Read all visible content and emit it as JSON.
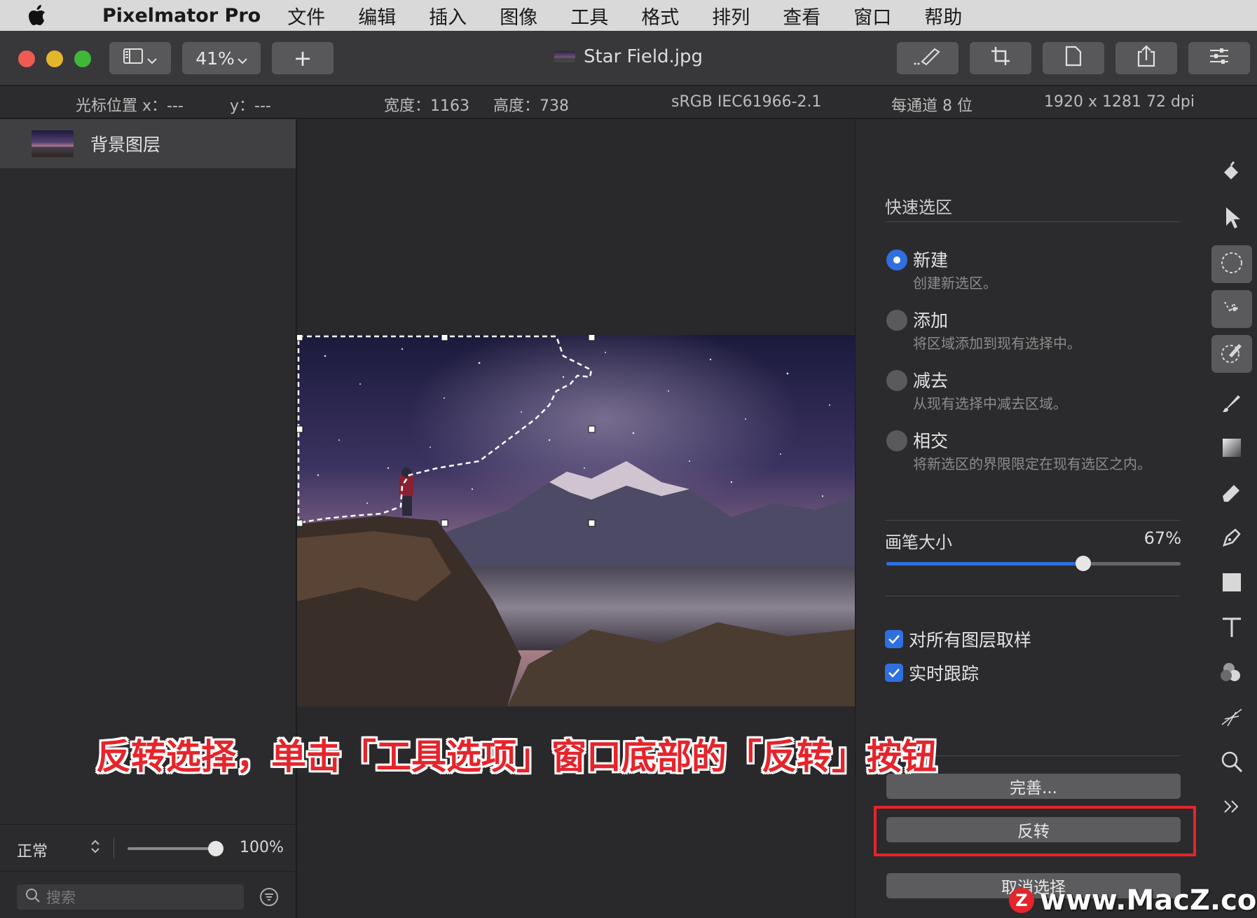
{
  "menubar": {
    "app_name": "Pixelmator Pro",
    "items": [
      "文件",
      "编辑",
      "插入",
      "图像",
      "工具",
      "格式",
      "排列",
      "查看",
      "窗口",
      "帮助"
    ]
  },
  "toolbar": {
    "zoom": "41%",
    "add_label": "+",
    "document_title": "Star Field.jpg"
  },
  "infobar": {
    "cursor_x": "光标位置 x：---",
    "cursor_y": "y：---",
    "width": "宽度：1163",
    "height": "高度：738",
    "color_profile": "sRGB IEC61966-2.1",
    "bit_depth": "每通道 8 位",
    "resolution": "1920 x 1281 72 dpi"
  },
  "layers": {
    "layer_name": "背景图层",
    "blend_mode": "正常",
    "opacity": "100%",
    "opacity_value": 1.0,
    "search_placeholder": "搜索"
  },
  "options": {
    "title": "快速选区",
    "modes": [
      {
        "label": "新建",
        "desc": "创建新选区。",
        "selected": true
      },
      {
        "label": "添加",
        "desc": "将区域添加到现有选择中。",
        "selected": false
      },
      {
        "label": "减去",
        "desc": "从现有选择中减去区域。",
        "selected": false
      },
      {
        "label": "相交",
        "desc": "将新选区的界限限定在现有选区之内。",
        "selected": false
      }
    ],
    "brush_size_label": "画笔大小",
    "brush_size_value": "67%",
    "brush_size_fraction": 0.67,
    "sample_all_layers": "对所有图层取样",
    "live_tracking": "实时跟踪",
    "refine_button": "完善...",
    "invert_button": "反转",
    "deselect_button": "取消选择"
  },
  "annotation": {
    "caption": "反转选择，单击「工具选项」窗口底部的「反转」按钮",
    "watermark": "www.MacZ.com",
    "watermark_logo": "Z"
  },
  "colors": {
    "accent": "#2f6fe0",
    "annotation_red": "#e5242b",
    "close": "#ed5b53",
    "minimize": "#e4b62c",
    "zoom": "#3fb83a"
  }
}
